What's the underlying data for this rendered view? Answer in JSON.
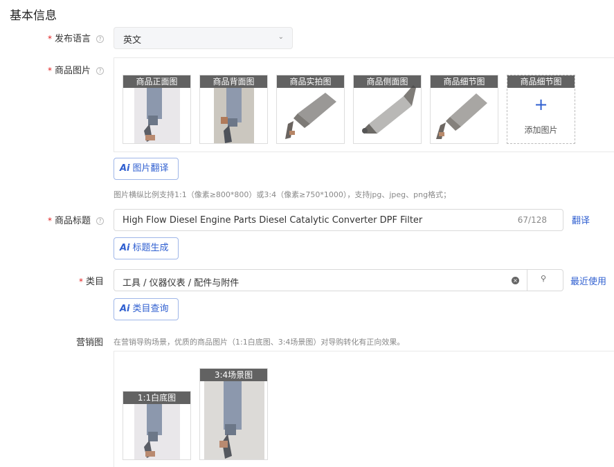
{
  "section": {
    "title": "基本信息"
  },
  "language": {
    "label": "发布语言",
    "value": "英文",
    "help_icon": "question-icon",
    "chevron_icon": "chevron-down-icon"
  },
  "images": {
    "label": "商品图片",
    "cards": [
      {
        "caption": "商品正面图"
      },
      {
        "caption": "商品背面图"
      },
      {
        "caption": "商品实拍图"
      },
      {
        "caption": "商品侧面图"
      },
      {
        "caption": "商品细节图"
      }
    ],
    "add_card": {
      "caption": "商品细节图",
      "plus": "+",
      "text": "添加图片"
    },
    "ai_button": {
      "icon": "Ai",
      "label": "图片翻译"
    },
    "hint": "图片横纵比例支持1:1（像素≥800*800）或3:4（像素≥750*1000），支持jpg、jpeg、png格式；"
  },
  "title_field": {
    "label": "商品标题",
    "value": "High Flow Diesel Engine Parts Diesel Catalytic Converter DPF Filter",
    "count": "67/128",
    "translate_link": "翻译",
    "ai_button": {
      "icon": "Ai",
      "label": "标题生成"
    }
  },
  "category": {
    "label": "类目",
    "value": "工具 / 仪器仪表 / 配件与附件",
    "clear_icon": "clear-icon",
    "search_icon": "search-icon",
    "recent_link": "最近使用",
    "ai_button": {
      "icon": "Ai",
      "label": "类目查询"
    }
  },
  "marketing": {
    "label": "营销图",
    "hint": "在营销导购场景，优质的商品图片（1:1白底图、3:4场景图）对导购转化有正向效果。",
    "cards": [
      {
        "caption": "1:1白底图"
      },
      {
        "caption": "3:4场景图"
      }
    ]
  },
  "colors": {
    "accent": "#2f5fd0",
    "required": "#e02020"
  }
}
